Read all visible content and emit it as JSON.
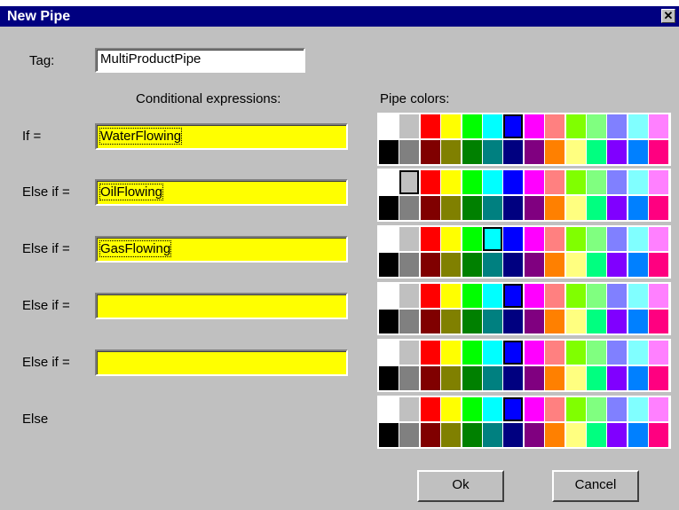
{
  "window": {
    "title": "New Pipe",
    "close_glyph": "✕"
  },
  "tag": {
    "label": "Tag:",
    "value": "MultiProductPipe"
  },
  "headers": {
    "conditions": "Conditional expressions:",
    "colors": "Pipe colors:"
  },
  "rows": [
    {
      "label": "If =",
      "expression": "WaterFlowing",
      "selected_color": "#0000ff"
    },
    {
      "label": "Else if =",
      "expression": "OilFlowing",
      "selected_color": "#c0c0c0"
    },
    {
      "label": "Else if =",
      "expression": "GasFlowing",
      "selected_color": "#00ffff"
    },
    {
      "label": "Else if =",
      "expression": "",
      "selected_color": "#0000ff"
    },
    {
      "label": "Else if =",
      "expression": "",
      "selected_color": "#0000ff"
    },
    {
      "label": "Else",
      "selected_color": "#0000ff"
    }
  ],
  "palette": {
    "top": [
      "#ffffff",
      "#c0c0c0",
      "#ff0000",
      "#ffff00",
      "#00ff00",
      "#00ffff",
      "#0000ff",
      "#ff00ff",
      "#ff8080",
      "#80ff00",
      "#80ff80",
      "#8080ff",
      "#80ffff",
      "#ff80ff"
    ],
    "bottom": [
      "#000000",
      "#808080",
      "#800000",
      "#808000",
      "#008000",
      "#008080",
      "#000080",
      "#800080",
      "#ff8000",
      "#ffff80",
      "#00ff80",
      "#8000ff",
      "#0080ff",
      "#ff0080"
    ]
  },
  "buttons": {
    "ok": "Ok",
    "cancel": "Cancel"
  }
}
